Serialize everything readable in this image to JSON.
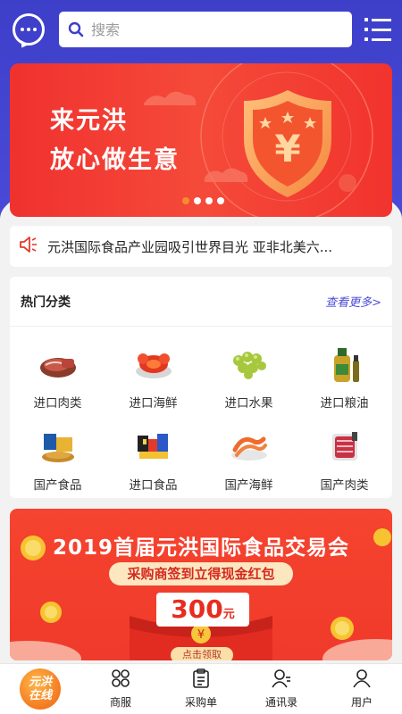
{
  "header": {
    "search_placeholder": "搜索"
  },
  "banner": {
    "line1": "来元洪",
    "line2": "放心做生意",
    "shield_symbol": "¥",
    "pages": 4,
    "active_page": 1
  },
  "notice": {
    "text": "元洪国际食品产业园吸引世界目光 亚非北美六..."
  },
  "hot_categories": {
    "title": "热门分类",
    "more": "查看更多>",
    "items": [
      {
        "label": "进口肉类",
        "icon": "meat-icon"
      },
      {
        "label": "进口海鲜",
        "icon": "lobster-icon"
      },
      {
        "label": "进口水果",
        "icon": "grape-icon"
      },
      {
        "label": "进口粮油",
        "icon": "oil-bottle-icon"
      },
      {
        "label": "国产食品",
        "icon": "snack-icon"
      },
      {
        "label": "进口食品",
        "icon": "imported-food-icon"
      },
      {
        "label": "国产海鲜",
        "icon": "shrimp-icon"
      },
      {
        "label": "国产肉类",
        "icon": "domestic-meat-icon"
      }
    ]
  },
  "promo": {
    "title": "2019首届元洪国际食品交易会",
    "subtitle": "采购商签到立得现金红包",
    "amount": "300",
    "amount_unit": "元",
    "button": "点击领取"
  },
  "tabbar": {
    "logo_text": "元洪\n在线",
    "items": [
      {
        "label": "商服",
        "icon": "grid-icon"
      },
      {
        "label": "采购单",
        "icon": "clipboard-icon"
      },
      {
        "label": "通讯录",
        "icon": "contacts-icon"
      },
      {
        "label": "用户",
        "icon": "user-icon"
      }
    ]
  },
  "colors": {
    "header_bg": "#3d3fc9",
    "banner_red": "#f0312e",
    "link_blue": "#4a4ad8",
    "dot_active": "#f78b2a"
  }
}
